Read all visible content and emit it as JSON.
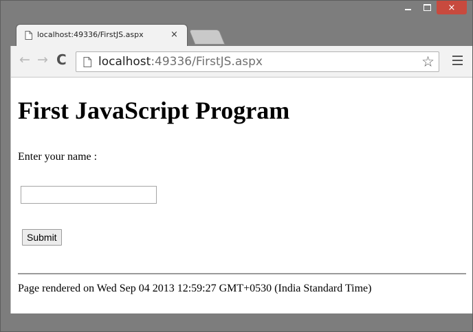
{
  "window": {
    "controls": {
      "minimize": "minimize",
      "maximize": "maximize",
      "close": "×"
    }
  },
  "tabs": [
    {
      "title": "localhost:49336/FirstJS.aspx",
      "close_label": "×",
      "icon": "page-icon"
    }
  ],
  "toolbar": {
    "back_label": "←",
    "forward_label": "→",
    "reload_label": "C",
    "url_host": "localhost",
    "url_rest": ":49336/FirstJS.aspx",
    "star_label": "☆",
    "menu_icon": "hamburger-menu-icon"
  },
  "page": {
    "heading": "First JavaScript Program",
    "prompt": "Enter your name :",
    "name_value": "",
    "submit_label": "Submit",
    "footer": "Page rendered on Wed Sep 04 2013 12:59:27 GMT+0530 (India Standard Time)"
  },
  "colors": {
    "frame": "#7d7d7d",
    "close_button": "#c84a3e",
    "toolbar": "#f2f2f2"
  }
}
